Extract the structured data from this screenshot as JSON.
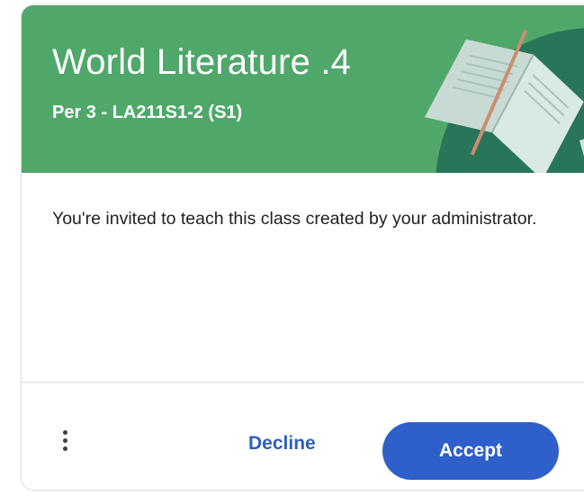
{
  "card": {
    "title": "World Literature .4",
    "section": "Per 3 - LA211S1-2 (S1)",
    "message": "You're invited to teach this class created by your administrator.",
    "icons": {
      "more": "more-vert-icon",
      "banner_art": "open-book-illustration"
    },
    "colors": {
      "banner": "#4fa86a",
      "accent": "#2f5fc8"
    }
  },
  "actions": {
    "decline_label": "Decline",
    "accept_label": "Accept"
  }
}
